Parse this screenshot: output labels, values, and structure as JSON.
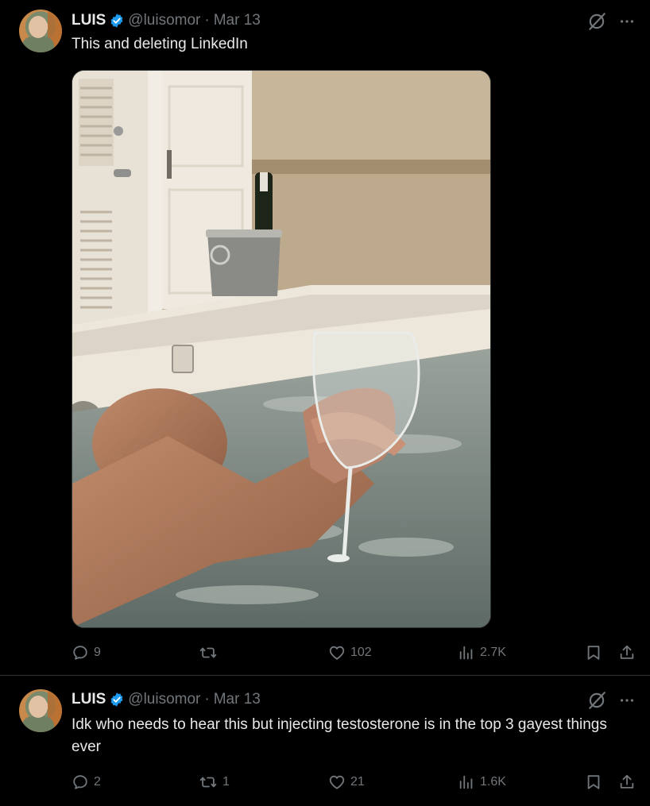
{
  "tweets": [
    {
      "author_name": "LUIS",
      "handle": "@luisomor",
      "separator": "·",
      "date": "Mar 13",
      "text": "This and deleting LinkedIn",
      "stats": {
        "replies": "9",
        "retweets": "",
        "likes": "102",
        "views": "2.7K"
      }
    },
    {
      "author_name": "LUIS",
      "handle": "@luisomor",
      "separator": "·",
      "date": "Mar 13",
      "text": "Idk who needs to hear this but injecting testosterone is in the top 3 gayest things ever",
      "stats": {
        "replies": "2",
        "retweets": "1",
        "likes": "21",
        "views": "1.6K"
      }
    }
  ],
  "icons": {
    "verified": "verified-badge-icon",
    "grok": "grok-icon",
    "more": "more-icon",
    "reply": "reply-icon",
    "retweet": "retweet-icon",
    "like": "like-icon",
    "views": "views-icon",
    "bookmark": "bookmark-icon",
    "share": "share-icon"
  },
  "colors": {
    "background": "#000000",
    "text": "#e7e9ea",
    "muted": "#71767b",
    "verified": "#1d9bf0",
    "divider": "#2f3336"
  }
}
